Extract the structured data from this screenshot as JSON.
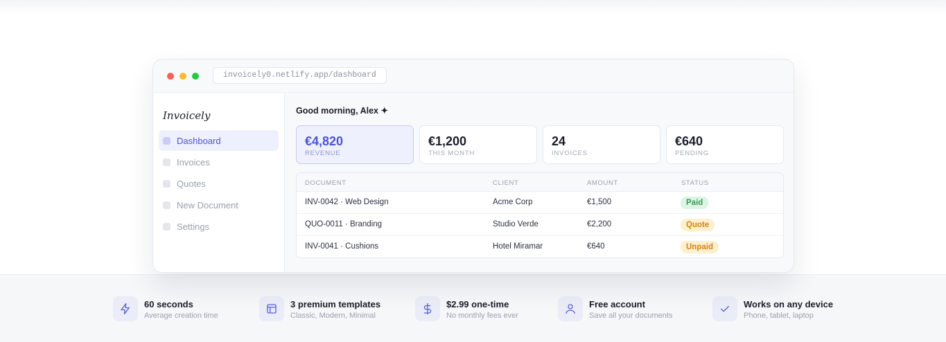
{
  "browser": {
    "url": "invoicely0.netlify.app/dashboard"
  },
  "sidebar": {
    "brand": "Invoicely",
    "items": [
      {
        "label": "Dashboard",
        "active": true
      },
      {
        "label": "Invoices",
        "active": false
      },
      {
        "label": "Quotes",
        "active": false
      },
      {
        "label": "New Document",
        "active": false
      },
      {
        "label": "Settings",
        "active": false
      }
    ]
  },
  "main": {
    "greeting": "Good morning, Alex ✦",
    "stats": [
      {
        "value": "€4,820",
        "label": "REVENUE"
      },
      {
        "value": "€1,200",
        "label": "THIS MONTH"
      },
      {
        "value": "24",
        "label": "INVOICES"
      },
      {
        "value": "€640",
        "label": "PENDING"
      }
    ],
    "table": {
      "headers": [
        "DOCUMENT",
        "CLIENT",
        "AMOUNT",
        "STATUS"
      ],
      "rows": [
        {
          "document": "INV-0042 · Web Design",
          "client": "Acme Corp",
          "amount": "€1,500",
          "status": "Paid"
        },
        {
          "document": "QUO-0011 · Branding",
          "client": "Studio Verde",
          "amount": "€2,200",
          "status": "Quote"
        },
        {
          "document": "INV-0041 · Cushions",
          "client": "Hotel Miramar",
          "amount": "€640",
          "status": "Unpaid"
        }
      ]
    }
  },
  "features": [
    {
      "icon": "lightning-icon",
      "title": "60 seconds",
      "subtitle": "Average creation time"
    },
    {
      "icon": "template-icon",
      "title": "3 premium templates",
      "subtitle": "Classic, Modern, Minimal"
    },
    {
      "icon": "dollar-icon",
      "title": "$2.99 one-time",
      "subtitle": "No monthly fees ever"
    },
    {
      "icon": "user-icon",
      "title": "Free account",
      "subtitle": "Save all your documents"
    },
    {
      "icon": "check-icon",
      "title": "Works on any device",
      "subtitle": "Phone, tablet, laptop"
    }
  ],
  "colors": {
    "accent": "#4c52d6",
    "accent_bg": "#eef0fd",
    "paid_bg": "#dcf5e4",
    "paid_text": "#2f9e57",
    "pending_bg": "#fdf0cf",
    "pending_text": "#d8820f"
  }
}
